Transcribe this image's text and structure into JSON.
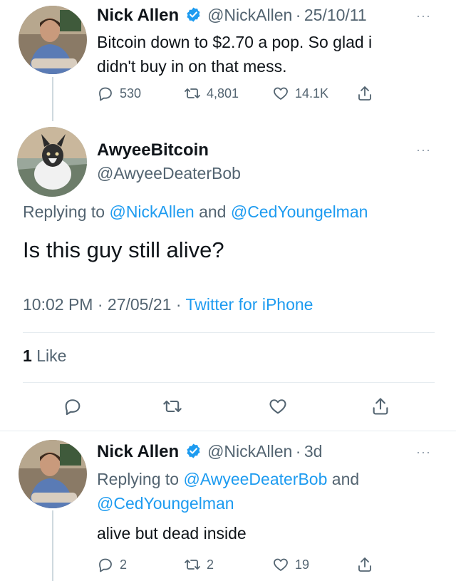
{
  "tweet1": {
    "name": "Nick Allen",
    "handle": "@NickAllen",
    "sep": "·",
    "date": "25/10/11",
    "text_line1": "Bitcoin down to $2.70 a pop. So glad i",
    "text_line2": "didn't buy in on that mess.",
    "replies": "530",
    "retweets": "4,801",
    "likes": "14.1K",
    "more": "···"
  },
  "tweet2": {
    "name": "AwyeeBitcoin",
    "handle": "@AwyeeDeaterBob",
    "replying_prefix": "Replying to",
    "replying_user1": "@NickAllen",
    "replying_and": "and",
    "replying_user2": "@CedYoungelman",
    "text": "Is this guy still alive?",
    "time": "10:02 PM",
    "sep1": "·",
    "date": "27/05/21",
    "sep2": "·",
    "source": "Twitter for iPhone",
    "likes_count": "1",
    "likes_label": "Like",
    "more": "···"
  },
  "tweet3": {
    "name": "Nick Allen",
    "handle": "@NickAllen",
    "sep": "·",
    "age": "3d",
    "replying_prefix": "Replying to",
    "replying_user1": "@AwyeeDeaterBob",
    "replying_and": "and",
    "replying_user2": "@CedYoungelman",
    "text": "alive but dead inside",
    "replies": "2",
    "retweets": "2",
    "likes": "19",
    "more": "···"
  },
  "colors": {
    "accent": "#1d9bf0",
    "text": "#0f1419",
    "secondary": "#536471",
    "divider": "#e6ecf0"
  },
  "icons": [
    "verified-badge-icon",
    "reply-icon",
    "retweet-icon",
    "like-icon",
    "share-icon",
    "more-icon"
  ]
}
